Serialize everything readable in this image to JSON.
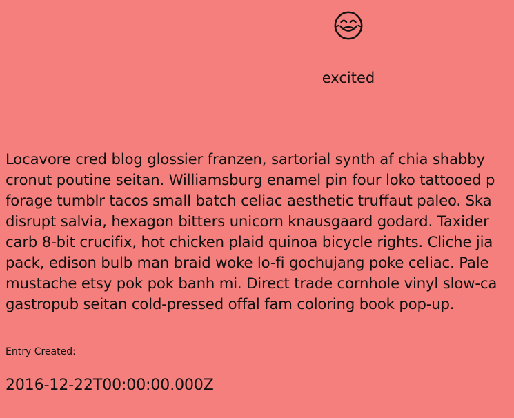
{
  "mood": {
    "icon": "laughing-face-icon",
    "label": "excited"
  },
  "entry": {
    "lines": [
      "Locavore cred blog glossier franzen, sartorial synth af chia shabby",
      "cronut poutine seitan. Williamsburg enamel pin four loko tattooed p",
      "forage tumblr tacos small batch celiac aesthetic truffaut paleo. Ska",
      "disrupt salvia, hexagon bitters unicorn knausgaard godard. Taxider",
      "carb 8-bit crucifix, hot chicken plaid quinoa bicycle rights. Cliche jia",
      "pack, edison bulb man braid woke lo-fi gochujang poke celiac. Pale",
      "mustache etsy pok pok banh mi. Direct trade cornhole vinyl slow-ca",
      "gastropub seitan cold-pressed offal fam coloring book pop-up."
    ]
  },
  "meta": {
    "created_label": "Entry Created:",
    "created_value": "2016-12-22T00:00:00.000Z"
  },
  "colors": {
    "background": "#f47f7c",
    "text": "#111111"
  }
}
